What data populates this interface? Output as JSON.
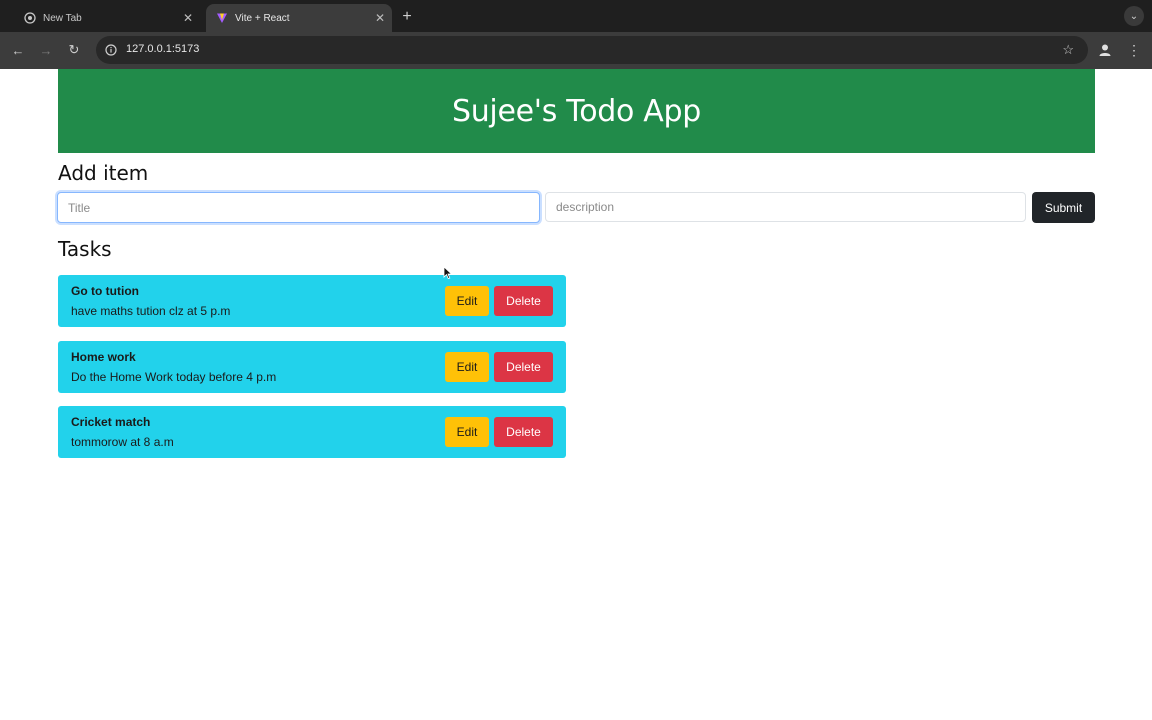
{
  "browser": {
    "tabs": [
      {
        "title": "New Tab",
        "active": false
      },
      {
        "title": "Vite + React",
        "active": true
      }
    ],
    "url": "127.0.0.1:5173"
  },
  "app": {
    "header_title": "Sujee's Todo App",
    "add_section_title": "Add item",
    "title_placeholder": "Title",
    "description_placeholder": "description",
    "submit_label": "Submit",
    "tasks_section_title": "Tasks",
    "tasks": [
      {
        "title": "Go to tution",
        "description": "have maths tution clz at 5 p.m"
      },
      {
        "title": "Home work",
        "description": "Do the Home Work today before 4 p.m"
      },
      {
        "title": "Cricket match",
        "description": "tommorow at 8 a.m"
      }
    ],
    "edit_label": "Edit",
    "delete_label": "Delete"
  },
  "colors": {
    "header_bg": "#218b4a",
    "task_bg": "#22d2eb",
    "edit_bg": "#ffc107",
    "delete_bg": "#dc3545",
    "submit_bg": "#212529"
  }
}
